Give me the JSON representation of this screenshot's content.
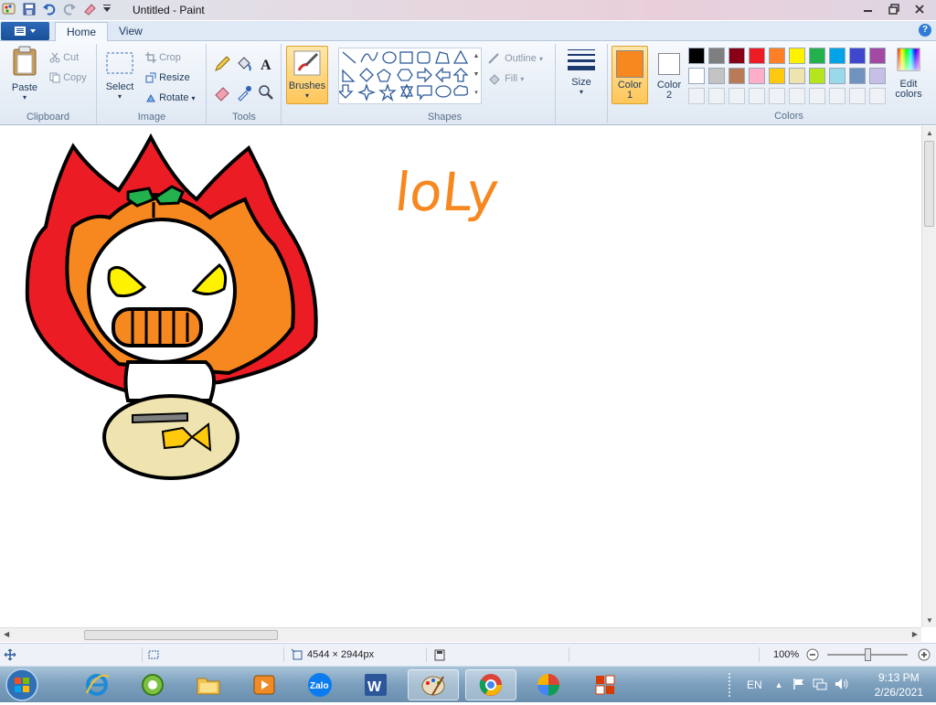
{
  "window": {
    "title": "Untitled - Paint"
  },
  "tabs": {
    "home": "Home",
    "view": "View"
  },
  "ribbon": {
    "clipboard": {
      "paste": "Paste",
      "cut": "Cut",
      "copy": "Copy",
      "label": "Clipboard"
    },
    "image": {
      "select": "Select",
      "crop": "Crop",
      "resize": "Resize",
      "rotate": "Rotate",
      "label": "Image"
    },
    "tools": {
      "label": "Tools"
    },
    "brushes": {
      "label": "Brushes"
    },
    "shapes": {
      "outline": "Outline",
      "fill": "Fill",
      "label": "Shapes"
    },
    "size": {
      "label": "Size"
    },
    "color1": {
      "line1": "Color",
      "line2": "1",
      "value": "#f7881f"
    },
    "color2": {
      "line1": "Color",
      "line2": "2",
      "value": "#ffffff"
    },
    "colors": {
      "label": "Colors",
      "row1": [
        "#000000",
        "#7f7f7f",
        "#880015",
        "#ed1c24",
        "#ff7f27",
        "#fff200",
        "#22b14c",
        "#00a2e8",
        "#3f48cc",
        "#a349a4"
      ],
      "row2": [
        "#ffffff",
        "#c3c3c3",
        "#b97a57",
        "#ffaec9",
        "#ffc90e",
        "#efe4b0",
        "#b5e61d",
        "#99d9ea",
        "#7092be",
        "#c8bfe7"
      ]
    },
    "edit_colors": {
      "line1": "Edit",
      "line2": "colors"
    }
  },
  "canvas": {
    "handwriting": "loLy"
  },
  "status": {
    "dimensions": "4544 × 2944px",
    "zoom": "100%"
  },
  "taskbar": {
    "lang": "EN",
    "time": "9:13 PM",
    "date": "2/26/2021",
    "apps": [
      "ie",
      "app-green",
      "explorer",
      "media",
      "Zalo",
      "W",
      "paint",
      "chrome",
      "app-colorful",
      "office"
    ]
  }
}
